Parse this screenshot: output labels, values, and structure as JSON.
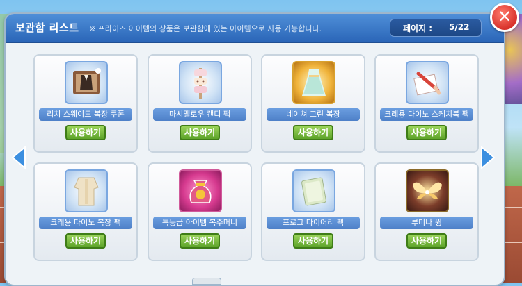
{
  "window": {
    "title": "보관함 리스트",
    "notice": "※ 프라이즈 아이템의 상품은 보관함에 있는 아이템으로 사용 가능합니다.",
    "page_label": "페이지 :",
    "page_value": "5/22",
    "close_label": "✕"
  },
  "use_label": "사용하기",
  "items": [
    {
      "name": "리치 스웨이드 복장 쿠폰",
      "icon": "suit-coupon-icon"
    },
    {
      "name": "마시멜로우 캔디 팩",
      "icon": "marshmallow-candy-icon"
    },
    {
      "name": "네이쳐 그린 복장",
      "icon": "green-dress-icon"
    },
    {
      "name": "크레용 다이노 스케치북 팩",
      "icon": "sketchbook-icon"
    },
    {
      "name": "크레용 다이노 복장 팩",
      "icon": "dino-outfit-icon"
    },
    {
      "name": "특등급 아이템 복주머니",
      "icon": "lucky-pouch-icon"
    },
    {
      "name": "프로그 다이어리 팩",
      "icon": "diary-icon"
    },
    {
      "name": "루미나 윙",
      "icon": "wing-icon"
    }
  ],
  "colors": {
    "header": "#3a78c9",
    "name_bar": "#5a8ed4",
    "use_button": "#7cbd3f",
    "close": "#e03a30"
  }
}
